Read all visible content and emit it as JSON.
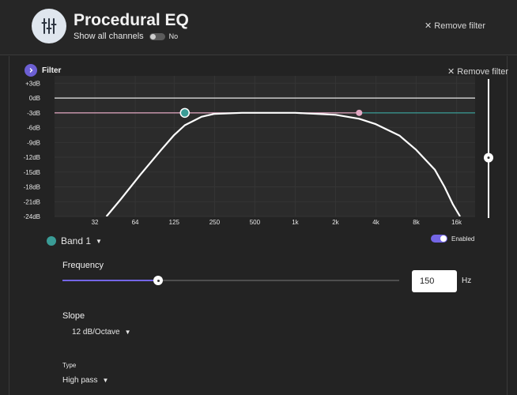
{
  "header": {
    "title": "Procedural EQ",
    "icon": "equalizer-icon",
    "show_all_label": "Show all channels",
    "show_all_value": "No",
    "remove_filter_label": "Remove filter"
  },
  "filter": {
    "label": "Filter",
    "remove_label": "Remove filter",
    "chart_data": {
      "type": "line",
      "y_ticks": [
        "+3dB",
        "0dB",
        "-3dB",
        "-6dB",
        "-9dB",
        "-12dB",
        "-15dB",
        "-18dB",
        "-21dB",
        "-24dB"
      ],
      "y_values": [
        3,
        0,
        -3,
        -6,
        -9,
        -12,
        -15,
        -18,
        -21,
        -24
      ],
      "x_ticks": [
        "32",
        "64",
        "125",
        "250",
        "500",
        "1k",
        "2k",
        "4k",
        "8k",
        "16k"
      ],
      "x_values": [
        32,
        64,
        125,
        250,
        500,
        1000,
        2000,
        4000,
        8000,
        16000
      ],
      "xscale": "log",
      "xlim": [
        16,
        22000
      ],
      "ylim": [
        -24,
        4.5
      ],
      "grid": true,
      "series": [
        {
          "color": "#ffffff",
          "points": [
            [
              39,
              -24
            ],
            [
              50,
              -20.5
            ],
            [
              70,
              -15.5
            ],
            [
              100,
              -10.5
            ],
            [
              125,
              -7.5
            ],
            [
              150,
              -5.5
            ],
            [
              200,
              -3.8
            ],
            [
              250,
              -3.2
            ],
            [
              400,
              -3.0
            ],
            [
              1000,
              -3.0
            ],
            [
              2000,
              -3.4
            ],
            [
              3000,
              -4.2
            ],
            [
              4000,
              -5.3
            ],
            [
              6000,
              -7.6
            ],
            [
              8000,
              -10.5
            ],
            [
              11000,
              -14.5
            ],
            [
              13000,
              -18.0
            ],
            [
              15000,
              -21.5
            ],
            [
              17000,
              -24
            ]
          ]
        }
      ],
      "reference_lines": [
        {
          "y": 0,
          "color": "#e8e8e8"
        },
        {
          "y": -3,
          "color": "#e3a8c3",
          "x_to": 3000
        },
        {
          "y": -3,
          "color": "#3a9c96",
          "x_from": 3000
        }
      ],
      "handles": [
        {
          "x": 150,
          "y": -3,
          "color": "#3a9c96"
        },
        {
          "x": 3000,
          "y": -3,
          "color": "#e3a8c3"
        }
      ],
      "colors": {
        "background": "#2b2b2b",
        "grid": "#353535",
        "curve": "#ffffff"
      }
    },
    "gain_slider_value_db": 0
  },
  "band": {
    "name": "Band 1",
    "color": "#3a9c96",
    "enabled_label": "Enabled",
    "enabled": true,
    "frequency_label": "Frequency",
    "frequency_value": "150",
    "frequency_unit": "Hz",
    "frequency_slider_fraction": 0.285,
    "slope_label": "Slope",
    "slope_value": "12 dB/Octave",
    "type_label": "Type",
    "type_value": "High pass"
  },
  "colors": {
    "accent": "#7466e6",
    "band": "#3a9c96",
    "pink": "#e3a8c3"
  }
}
